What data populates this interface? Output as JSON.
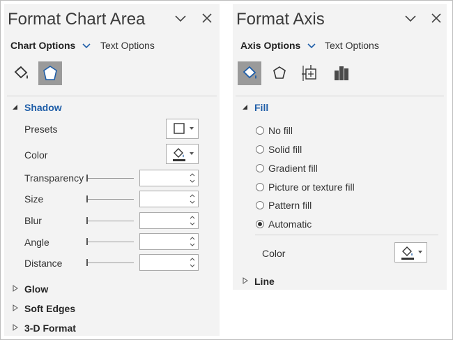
{
  "left_pane": {
    "title": "Format Chart Area",
    "tabs": {
      "active": "Chart Options",
      "inactive": "Text Options"
    },
    "icons": [
      "fill-line-icon",
      "effects-icon"
    ],
    "shadow_section": {
      "heading": "Shadow",
      "presets_label": "Presets",
      "color_label": "Color",
      "transparency_label": "Transparency",
      "size_label": "Size",
      "blur_label": "Blur",
      "angle_label": "Angle",
      "distance_label": "Distance"
    },
    "collapsed_sections": [
      "Glow",
      "Soft Edges",
      "3-D Format"
    ]
  },
  "right_pane": {
    "title": "Format Axis",
    "tabs": {
      "active": "Axis Options",
      "inactive": "Text Options"
    },
    "icons": [
      "fill-line-icon",
      "effects-icon",
      "size-properties-icon",
      "axis-options-icon"
    ],
    "fill_section": {
      "heading": "Fill",
      "options": [
        "No fill",
        "Solid fill",
        "Gradient fill",
        "Picture or texture fill",
        "Pattern fill",
        "Automatic"
      ],
      "selected": "Automatic",
      "color_label": "Color"
    },
    "line_section": {
      "heading": "Line"
    }
  },
  "colors": {
    "accent": "#1f5ea8",
    "pane_bg": "#f3f3f3",
    "active_icon_bg": "#9a9a9a"
  }
}
